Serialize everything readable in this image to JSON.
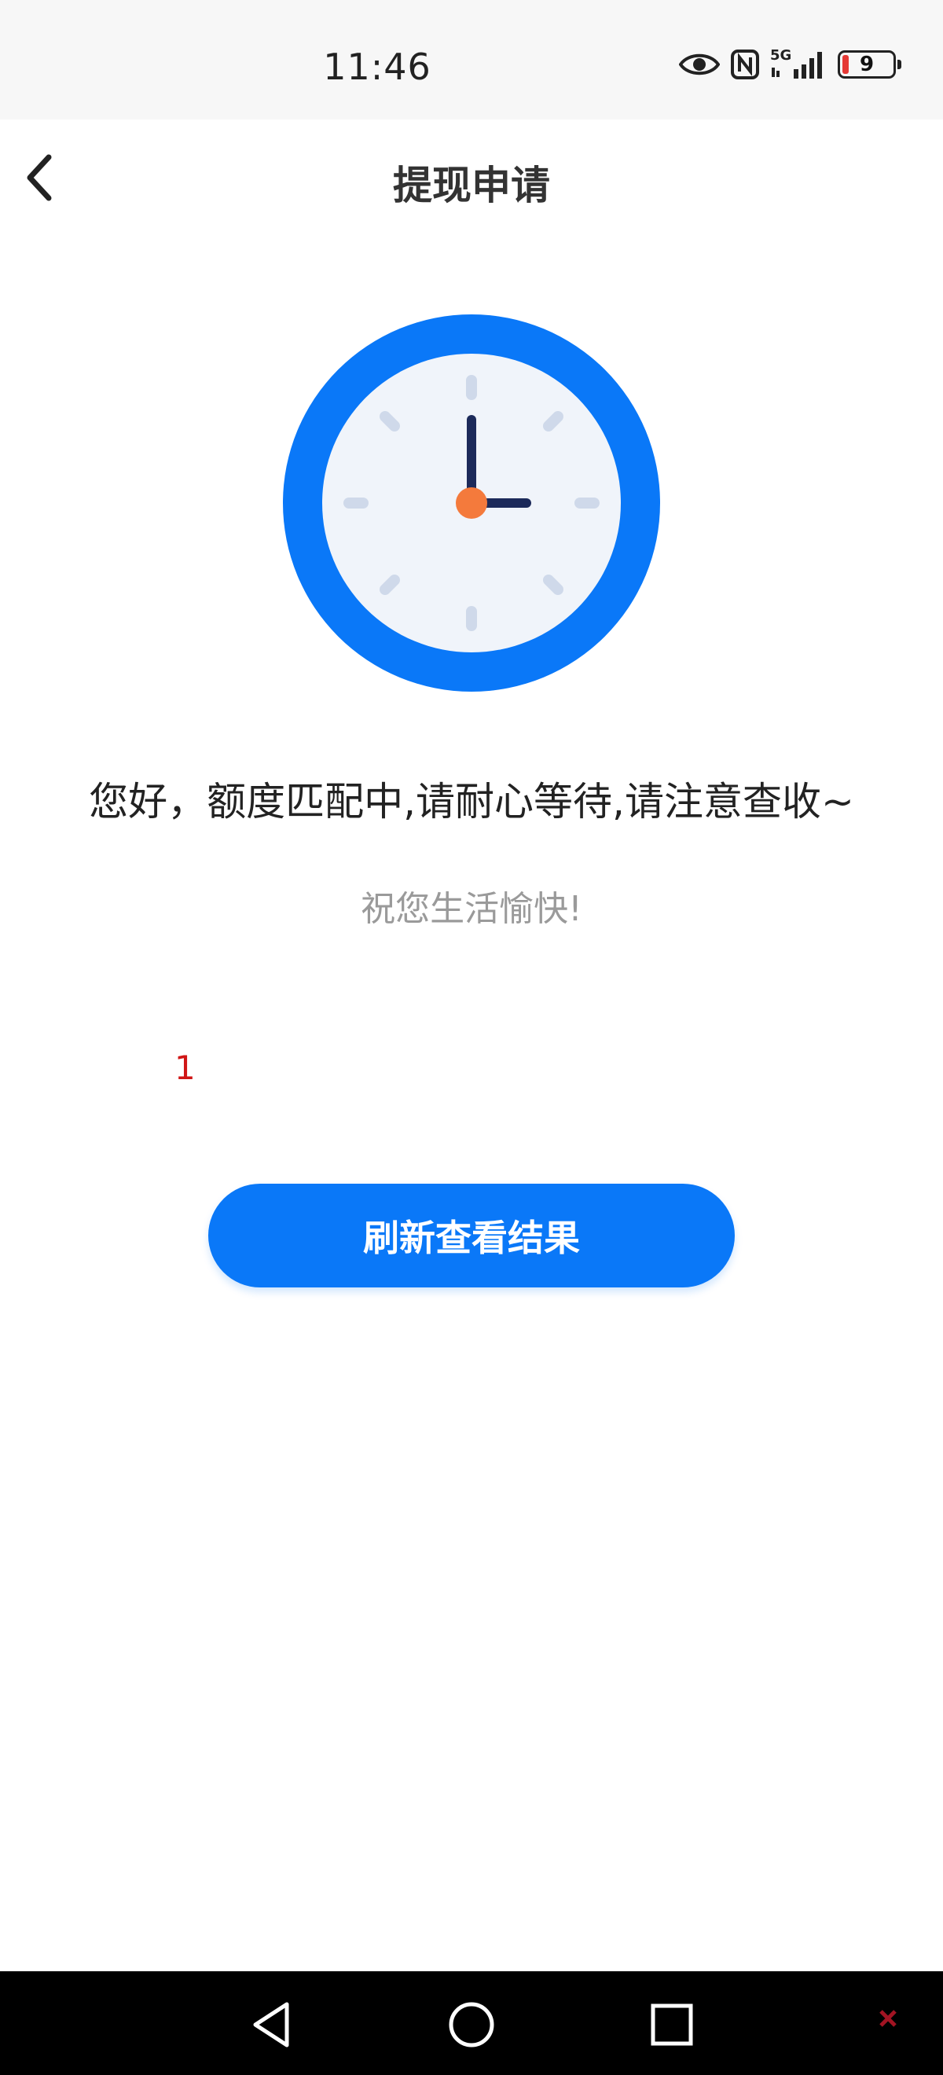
{
  "status_bar": {
    "time": "11:46",
    "battery_level": "9",
    "network_label": "5G",
    "icons": [
      "eye-icon",
      "nfc-icon",
      "signal-icon",
      "battery-icon"
    ]
  },
  "header": {
    "title": "提现申请",
    "back_icon": "chevron-left-icon"
  },
  "main": {
    "illustration": "clock-icon",
    "message": "您好，额度匹配中,请耐心等待,请注意查收~",
    "sub_message": "祝您生活愉快!",
    "number_label": "1",
    "refresh_button_label": "刷新查看结果"
  },
  "colors": {
    "accent_blue": "#0a78f8",
    "clock_face": "#f0f4fa",
    "clock_center": "#f47a3c",
    "red_text": "#d01616"
  },
  "navigation_bar": {
    "buttons": [
      "back-triangle-icon",
      "home-circle-icon",
      "recents-square-icon"
    ]
  }
}
